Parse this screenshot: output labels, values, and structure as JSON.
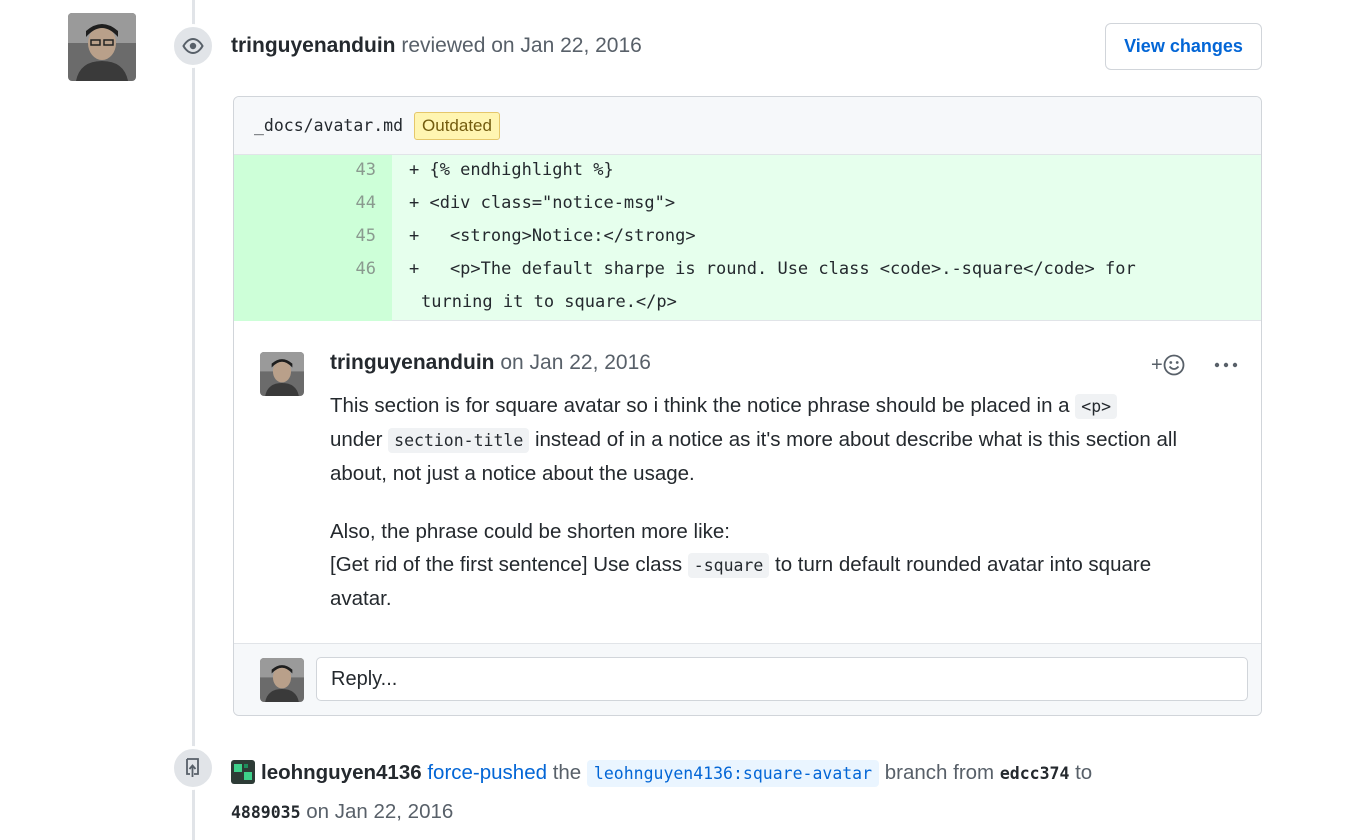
{
  "review": {
    "author": "tringuyenanduin",
    "action": "reviewed on Jan 22, 2016",
    "view_changes_label": "View changes",
    "file_path": "_docs/avatar.md",
    "outdated_label": "Outdated",
    "diff_lines": [
      {
        "num": "43",
        "code": "+ {% endhighlight %}"
      },
      {
        "num": "44",
        "code": "+ <div class=\"notice-msg\">"
      },
      {
        "num": "45",
        "code": "+   <strong>Notice:</strong>"
      },
      {
        "num": "46",
        "code": "+   <p>The default sharpe is round. Use class <code>.-square</code> for",
        "wrap": "turning it to square.</p>"
      }
    ]
  },
  "comment": {
    "author": "tringuyenanduin",
    "date": "on Jan 22, 2016",
    "p1_a": "This section is for square avatar so i think the notice phrase should be placed in a ",
    "p1_code1": "<p>",
    "p1_b": "under ",
    "p1_code2": "section-title",
    "p1_c": " instead of in a notice as it's more about describe what is this section all about, not just a notice about the usage.",
    "p2_line1": "Also, the phrase could be shorten more like:",
    "p2_a": "[Get rid of the first sentence] Use class ",
    "p2_code": "-square",
    "p2_b": " to turn default rounded avatar into square avatar.",
    "reaction_plus": "+"
  },
  "reply": {
    "placeholder": "Reply..."
  },
  "push_event": {
    "author": "leohnguyen4136",
    "action": "force-pushed",
    "the": " the ",
    "branch": "leohnguyen4136:square-avatar",
    "from_text": " branch from ",
    "from_sha": "edcc374",
    "to_text": " to",
    "to_sha": "4889035",
    "date": " on Jan 22, 2016"
  },
  "icons": {
    "review": "eye-icon",
    "push": "repo-push-icon",
    "reaction": "smiley-icon",
    "more": "kebab-horizontal-icon"
  },
  "colors": {
    "link": "#0366d6",
    "diff_add_bg": "#e6ffed",
    "outdated_bg": "#fff5b1"
  }
}
